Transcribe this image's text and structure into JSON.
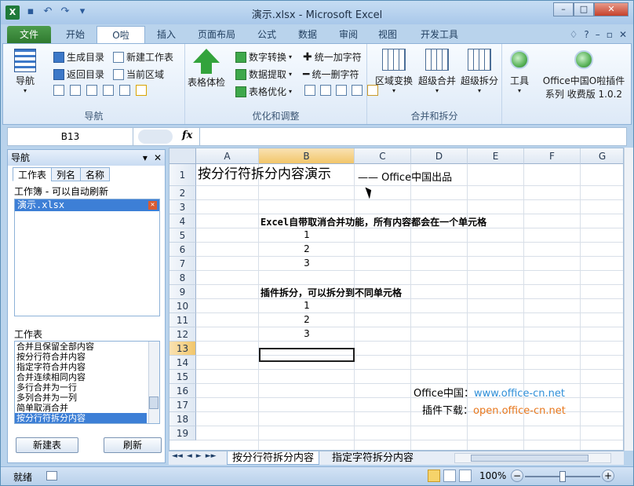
{
  "window": {
    "title": "演示.xlsx - Microsoft Excel",
    "app_icon": "X",
    "controls": [
      "–",
      "□",
      "✕"
    ]
  },
  "qat": {
    "icons": [
      "save-icon",
      "undo-icon",
      "redo-icon",
      "customize-icon"
    ]
  },
  "ribbon_tabs": {
    "file": "文件",
    "tabs": [
      "开始",
      "O啦",
      "插入",
      "页面布局",
      "公式",
      "数据",
      "审阅",
      "视图",
      "开发工具"
    ],
    "active": "O啦",
    "help": "?"
  },
  "ribbon": {
    "nav_group": {
      "label": "导航",
      "nav_button": "导航",
      "items": [
        "生成目录",
        "新建工作表",
        "返回目录",
        "当前区域"
      ]
    },
    "optimize_group": {
      "label": "优化和调整",
      "check_button": "表格体检",
      "items": [
        "数字转换",
        "统一加字符",
        "数据提取",
        "统一删字符",
        "表格优化"
      ]
    },
    "merge_group": {
      "label": "合并和拆分",
      "items": [
        "区域变换",
        "超级合并",
        "超级拆分"
      ]
    },
    "tools": {
      "tool_button": "工具",
      "plugin_line1": "Office中国O啦插件",
      "plugin_line2": "系列 收费版 1.0.2"
    }
  },
  "formula_bar": {
    "name_box": "B13",
    "fx": "fx",
    "content": ""
  },
  "nav_pane": {
    "title": "导航",
    "tabs": [
      "工作表",
      "列名",
      "名称"
    ],
    "workbook_hint": "工作簿 - 可以自动刷新",
    "workbooks": [
      "演示.xlsx"
    ],
    "sheets_label": "工作表",
    "sheets": [
      "合并且保留全部内容",
      "按分行符合并内容",
      "指定字符合并内容",
      "合并连续相同内容",
      "多行合并为一行",
      "多列合并为一列",
      "简单取消合并",
      "按分行符拆分内容"
    ],
    "selected_sheet": "按分行符拆分内容",
    "new_button": "新建表",
    "refresh_button": "刷新"
  },
  "sheet": {
    "columns": [
      "A",
      "B",
      "C",
      "D",
      "E",
      "F",
      "G"
    ],
    "rows": [
      "1",
      "2",
      "3",
      "4",
      "5",
      "6",
      "7",
      "8",
      "9",
      "10",
      "11",
      "12",
      "13",
      "14",
      "15",
      "16",
      "17",
      "18",
      "19"
    ],
    "title": "按分行符拆分内容演示",
    "subtitle": "—— Office中国出品",
    "note1": "Excel自带取消合并功能，所有内容都会在一个单元格",
    "values_a": [
      "1",
      "2",
      "3"
    ],
    "note2": "插件拆分，可以拆分到不同单元格",
    "values_b": [
      "1",
      "2",
      "3"
    ],
    "footer_label1": "Office中国：",
    "footer_link1": "www.office-cn.net",
    "footer_label2": "插件下载：",
    "footer_link2": "open.office-cn.net",
    "link_color1": "#2f8fd8",
    "link_color2": "#e8781e"
  },
  "sheet_tabs": {
    "nav": [
      "◄◄",
      "◄",
      "►",
      "►►"
    ],
    "tabs": [
      "按分行符拆分内容",
      "指定字符拆分内容"
    ],
    "active": "按分行符拆分内容"
  },
  "status": {
    "ready": "就绪",
    "zoom": "100%"
  }
}
